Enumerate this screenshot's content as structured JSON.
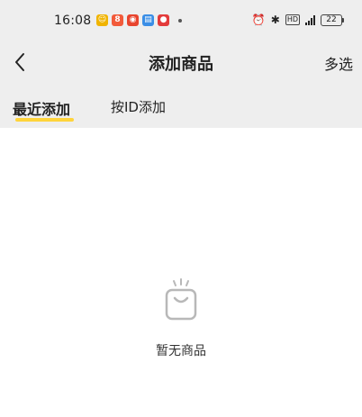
{
  "status_bar": {
    "time": "16:08",
    "battery": "22",
    "hd_label": "HD"
  },
  "header": {
    "title": "添加商品",
    "multi_select_label": "多选"
  },
  "tabs": [
    {
      "label": "最近添加",
      "active": true
    },
    {
      "label": "按ID添加",
      "active": false
    }
  ],
  "empty_state": {
    "message": "暂无商品",
    "icon": "shopping-bag-icon"
  },
  "colors": {
    "accent": "#ffd43b",
    "band_background": "#eeeeee",
    "icon_gray": "#b8b8b8"
  }
}
